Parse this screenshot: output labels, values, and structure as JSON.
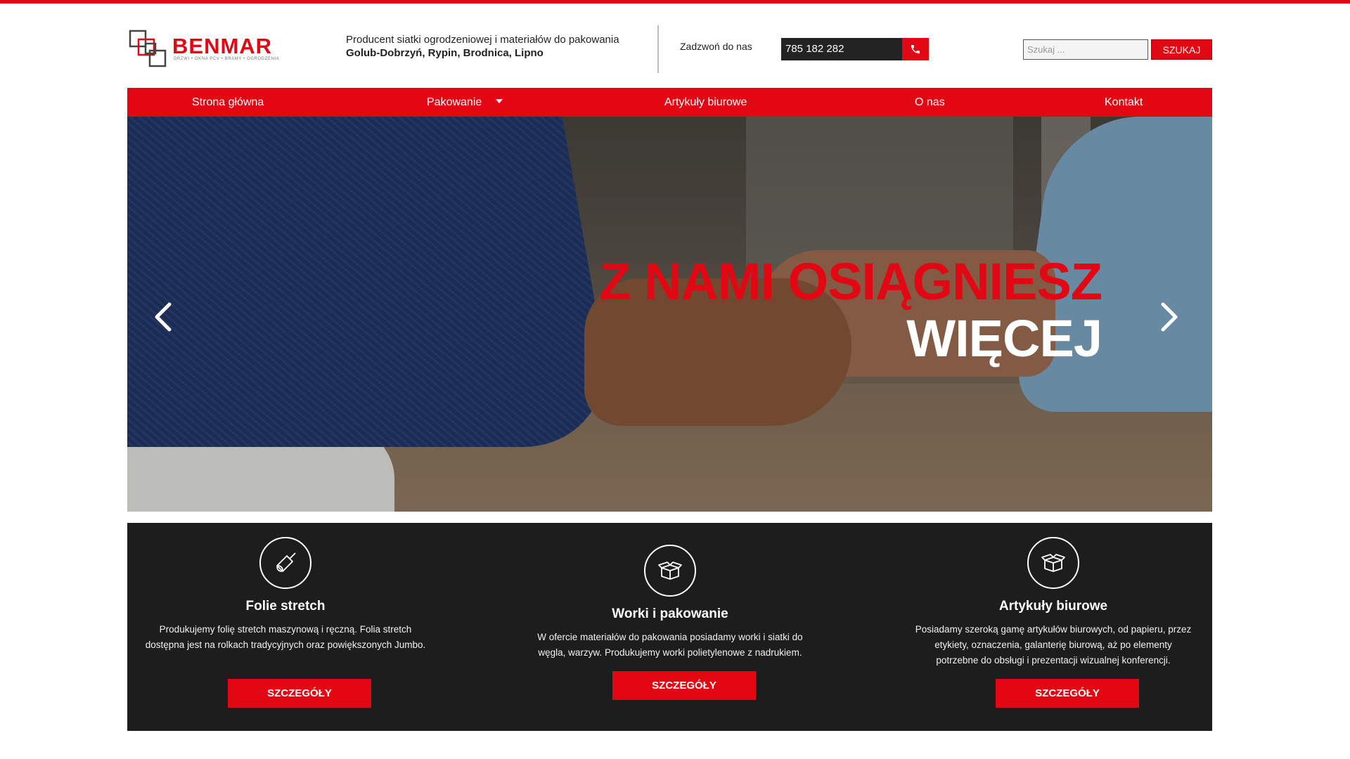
{
  "brand": {
    "name": "BENMAR",
    "tagline": "DRZWI • OKNA PCV • BRAMY • OGRODZENIA",
    "accent_color": "#e30613"
  },
  "header": {
    "info_line1": "Producent siatki ogrodzeniowej i materiałów do pakowania",
    "info_line2": "Golub-Dobrzyń, Rypin, Brodnica, Lipno",
    "call_label": "Zadzwoń do nas",
    "phone": "785 182 282",
    "phone_icon": "phone-icon",
    "search_placeholder": "Szukaj ...",
    "search_button": "SZUKAJ"
  },
  "nav": {
    "items": [
      {
        "label": "Strona główna"
      },
      {
        "label": "Pakowanie",
        "has_dropdown": true
      },
      {
        "label": "Artykuły biurowe"
      },
      {
        "label": "O nas"
      },
      {
        "label": "Kontakt"
      }
    ]
  },
  "hero": {
    "title_line1": "Z NAMI OSIĄGNIESZ",
    "title_line2": "WIĘCEJ",
    "prev_icon": "chevron-left-icon",
    "next_icon": "chevron-right-icon"
  },
  "features": [
    {
      "icon": "stretch-film-roll-icon",
      "title": "Folie stretch",
      "text": "Produkujemy folię stretch maszynową i ręczną. Folia stretch dostępna jest na rolkach tradycyjnych oraz powiększonych Jumbo.",
      "button": "SZCZEGÓŁY"
    },
    {
      "icon": "open-box-icon",
      "title": "Worki i pakowanie",
      "text": "W ofercie materiałów do pakowania posiadamy worki i siatki do węgla, warzyw. Produkujemy worki polietylenowe z nadrukiem.",
      "button": "SZCZEGÓŁY"
    },
    {
      "icon": "open-box-icon",
      "title": "Artykuły biurowe",
      "text": "Posiadamy szeroką gamę artykułów biurowych, od papieru, przez etykiety, oznaczenia, galanterię biurową, aż po elementy potrzebne do obsługi i prezentacji wizualnej konferencji.",
      "button": "SZCZEGÓŁY"
    }
  ]
}
